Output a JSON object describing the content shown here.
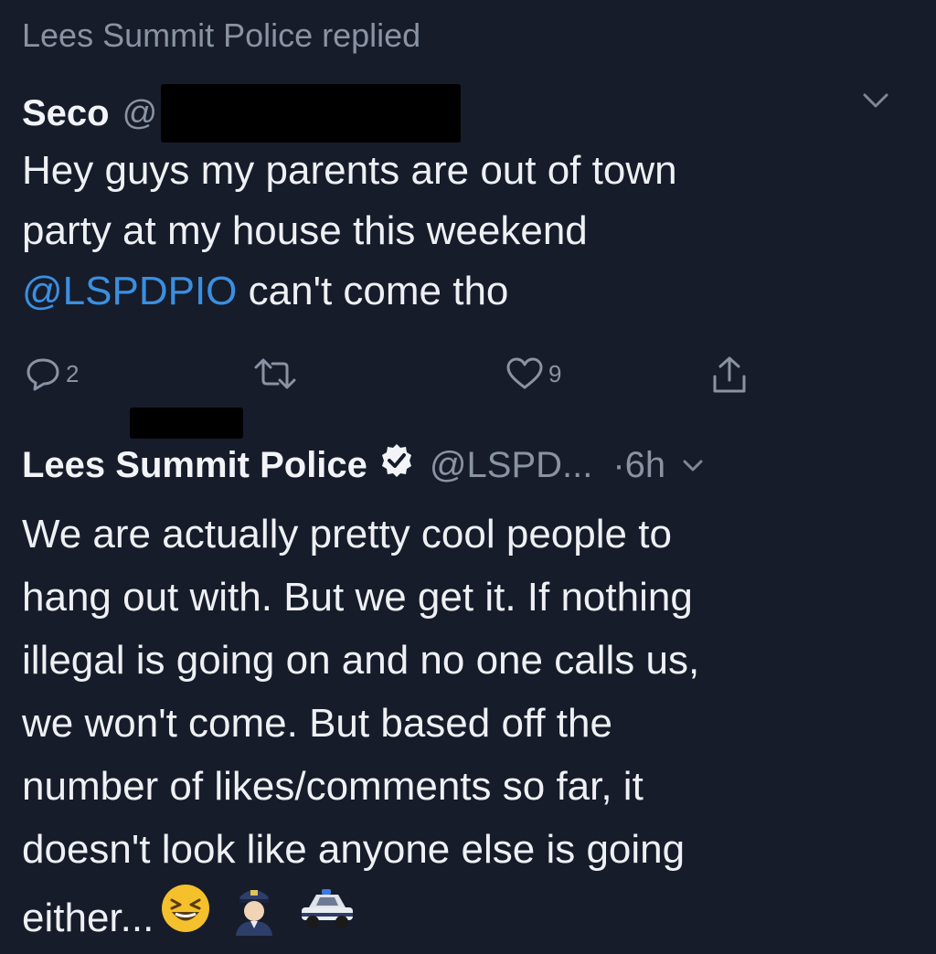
{
  "context": {
    "text": "Lees Summit Police replied"
  },
  "original_tweet": {
    "display_name": "Seco",
    "handle_prefix": "@",
    "lines": [
      "Hey guys my parents are out of town",
      "party at my house this weekend"
    ],
    "mention": "@LSPDPIO",
    "mention_suffix": " can't come tho",
    "actions": {
      "reply_count": "2",
      "like_count": "9"
    }
  },
  "reply_tweet": {
    "display_name": "Lees Summit Police",
    "handle": "@LSPD...",
    "time": "·6h",
    "lines": [
      "We are actually pretty cool people to",
      "hang out with.  But we get it.  If nothing",
      "illegal is going on and no one calls us,",
      "we won't come.  But based off the",
      "number of likes/comments so far, it",
      "doesn't look like anyone else is going",
      "either..."
    ]
  },
  "icons": [
    "chevron-down-icon",
    "reply-icon",
    "retweet-icon",
    "like-icon",
    "share-icon",
    "verified-badge-icon",
    "laughing-emoji",
    "police-officer-emoji",
    "police-car-emoji"
  ],
  "colors": {
    "background": "#161c2a",
    "mention": "#3b8fe0",
    "muted": "#8a93a3",
    "text": "#eef0f4"
  }
}
